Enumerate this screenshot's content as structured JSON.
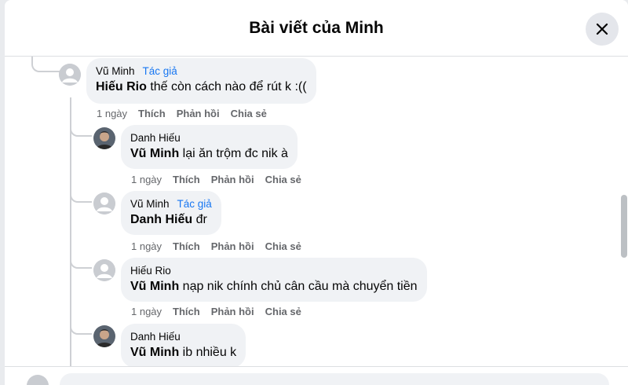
{
  "header": {
    "title": "Bài viết của Minh",
    "close_icon": "close-icon"
  },
  "comments": [
    {
      "author": "Vũ Minh",
      "badge": "Tác giả",
      "mention": "Hiếu Rio",
      "text": " thế còn cách nào để rút k :((",
      "time": "1 ngày",
      "like": "Thích",
      "reply": "Phản hồi",
      "share": "Chia sẻ",
      "avatar": "default-avatar"
    },
    {
      "author": "Danh Hiếu",
      "mention": "Vũ Minh",
      "text": " lại ăn trộm đc nik à",
      "time": "1 ngày",
      "like": "Thích",
      "reply": "Phản hồi",
      "share": "Chia sẻ",
      "avatar": "photo-avatar"
    },
    {
      "author": "Vũ Minh",
      "badge": "Tác giả",
      "mention": "Danh Hiếu",
      "text": " đr",
      "time": "1 ngày",
      "like": "Thích",
      "reply": "Phản hồi",
      "share": "Chia sẻ",
      "avatar": "default-avatar"
    },
    {
      "author": "Hiếu Rio",
      "mention": "Vũ Minh",
      "text": " nạp nik chính chủ cân cầu mà chuyển tiền",
      "time": "1 ngày",
      "like": "Thích",
      "reply": "Phản hồi",
      "share": "Chia sẻ",
      "avatar": "default-avatar"
    },
    {
      "author": "Danh Hiếu",
      "mention": "Vũ Minh",
      "text": " ib nhiều k",
      "avatar": "photo-avatar"
    }
  ]
}
